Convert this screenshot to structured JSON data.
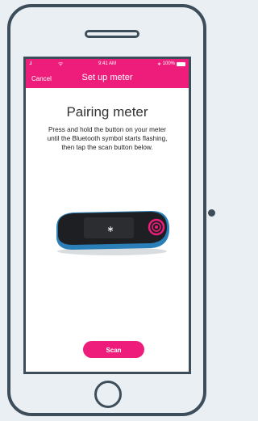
{
  "statusbar": {
    "signal": "..ıl",
    "wifi": "ᯤ",
    "time": "9:41 AM",
    "bluetooth": "∗",
    "battery": "100%"
  },
  "navbar": {
    "cancel": "Cancel",
    "title": "Set up meter"
  },
  "main": {
    "heading": "Pairing meter",
    "instructions": "Press and hold the button on your meter until the Bluetooth symbol starts flashing, then tap the scan button below.",
    "meter_symbol": "∗",
    "scan_label": "Scan"
  },
  "colors": {
    "accent": "#ee1d7b",
    "outline": "#3d4d5a",
    "meter_blue": "#2a7fb8"
  },
  "icons": [
    "signal-icon",
    "wifi-icon",
    "bluetooth-icon",
    "battery-icon",
    "glucose-meter-image"
  ]
}
